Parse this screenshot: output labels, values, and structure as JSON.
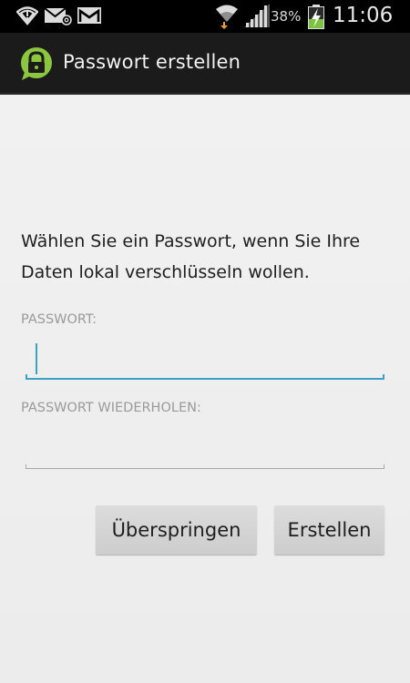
{
  "status_bar": {
    "battery_percent": "38%",
    "time": "11:06",
    "icons": [
      "wifi-warning-icon",
      "email-at-icon",
      "gmail-icon",
      "wifi-download-icon",
      "signal-icon",
      "battery-charging-icon"
    ]
  },
  "app_bar": {
    "title": "Passwort erstellen",
    "logo_icon": "lock-speech-bubble-icon",
    "accent_color": "#8cc63f"
  },
  "main": {
    "intro_text": "Wählen Sie ein Passwort, wenn Sie Ihre Daten lokal verschlüsseln wollen.",
    "password_label": "PASSWORT:",
    "password_value": "",
    "repeat_label": "PASSWORT WIEDERHOLEN:",
    "repeat_value": "",
    "focus_color": "#3ba1c9"
  },
  "buttons": {
    "skip_label": "Überspringen",
    "create_label": "Erstellen"
  }
}
